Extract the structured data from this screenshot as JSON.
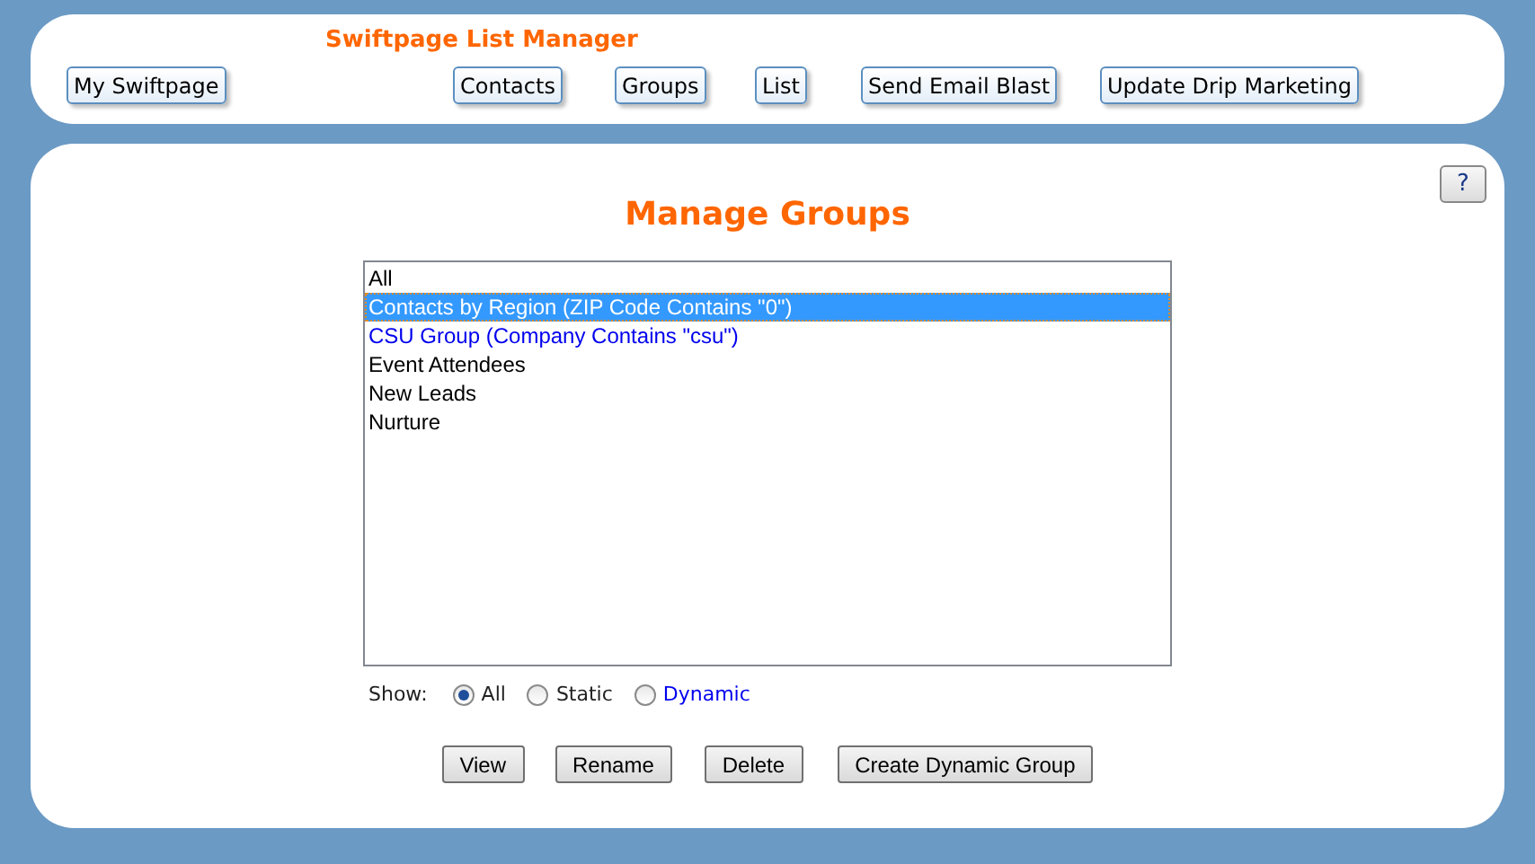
{
  "header": {
    "title": "Swiftpage List Manager",
    "nav": [
      {
        "label": "My Swiftpage"
      },
      {
        "label": "Contacts"
      },
      {
        "label": "Groups"
      },
      {
        "label": "List"
      },
      {
        "label": "Send Email Blast"
      },
      {
        "label": "Update Drip Marketing"
      }
    ]
  },
  "help_button": "?",
  "page_title": "Manage Groups",
  "groups": [
    {
      "label": "All",
      "selected": false,
      "dynamic": false
    },
    {
      "label": "Contacts by Region (ZIP Code Contains \"0\")",
      "selected": true
    },
    {
      "label": "CSU Group (Company Contains \"csu\")",
      "selected": false,
      "dynamic": true
    },
    {
      "label": "Event Attendees",
      "selected": false,
      "dynamic": false
    },
    {
      "label": "New Leads",
      "selected": false,
      "dynamic": false
    },
    {
      "label": "Nurture",
      "selected": false,
      "dynamic": false
    }
  ],
  "filter": {
    "label": "Show:",
    "options": [
      {
        "label": "All",
        "selected": true,
        "dynamic": false
      },
      {
        "label": "Static",
        "selected": false,
        "dynamic": false
      },
      {
        "label": "Dynamic",
        "selected": false,
        "dynamic": true
      }
    ]
  },
  "actions": [
    "View",
    "Rename",
    "Delete",
    "Create Dynamic Group"
  ]
}
